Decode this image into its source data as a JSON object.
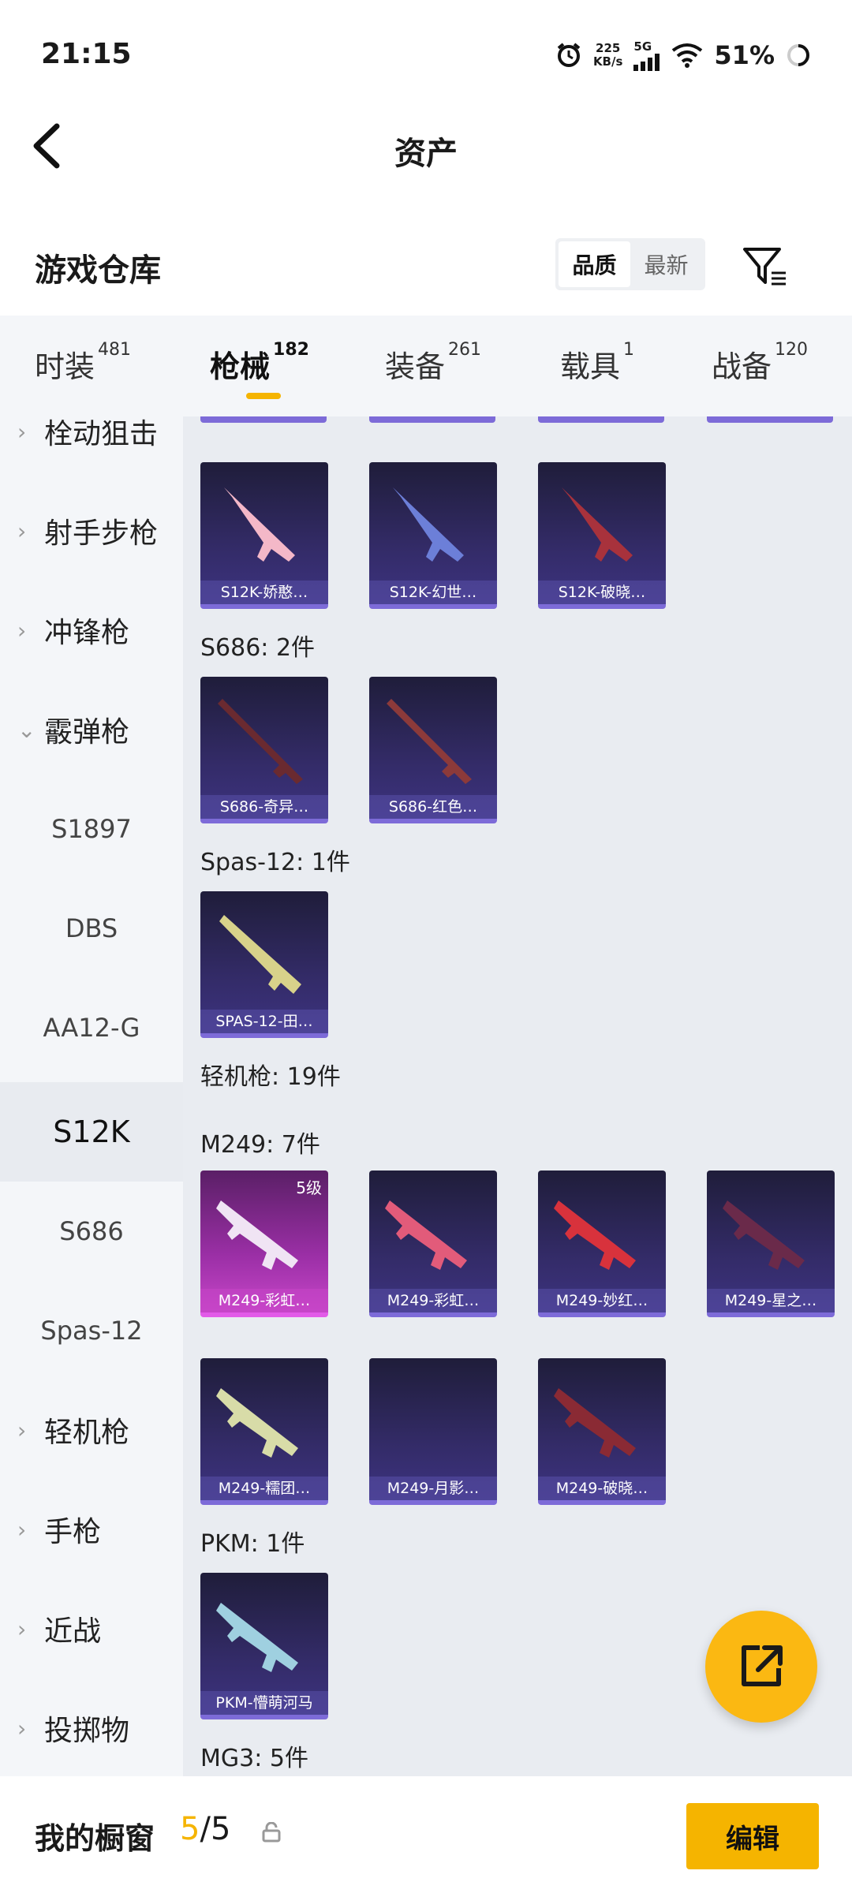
{
  "status_bar": {
    "time": "21:15",
    "network_speed_value": "225",
    "network_speed_unit": "KB/s",
    "signal": "5G",
    "battery": "51%",
    "icons": [
      "alarm-icon",
      "signal-icon",
      "wifi-icon",
      "battery-icon"
    ]
  },
  "header": {
    "title": "资产"
  },
  "warehouse": {
    "title": "游戏仓库",
    "sort_options": [
      "品质",
      "最新"
    ],
    "selected_sort": "品质"
  },
  "tabs": [
    {
      "label": "时装",
      "count": "481"
    },
    {
      "label": "枪械",
      "count": "182",
      "active": true
    },
    {
      "label": "装备",
      "count": "261"
    },
    {
      "label": "载具",
      "count": "1"
    },
    {
      "label": "战备",
      "count": "120"
    }
  ],
  "sidebar": {
    "categories": [
      {
        "label": "栓动狙击",
        "expanded": false
      },
      {
        "label": "射手步枪",
        "expanded": false
      },
      {
        "label": "冲锋枪",
        "expanded": false
      },
      {
        "label": "霰弹枪",
        "expanded": true
      },
      {
        "label": "轻机枪",
        "expanded": false
      },
      {
        "label": "手枪",
        "expanded": false
      },
      {
        "label": "近战",
        "expanded": false
      },
      {
        "label": "投掷物",
        "expanded": false
      }
    ],
    "subitems": [
      "S1897",
      "DBS",
      "AA12-G",
      "S12K",
      "S686",
      "Spas-12"
    ],
    "selected_subitem": "S12K"
  },
  "content": {
    "s12k_items": [
      "S12K-娇憨…",
      "S12K-幻世…",
      "S12K-破晓…"
    ],
    "s686_label": "S686: 2件",
    "s686_items": [
      "S686-奇异…",
      "S686-红色…"
    ],
    "spas_label": "Spas-12: 1件",
    "spas_items": [
      "SPAS-12-田…"
    ],
    "lmg_label": "轻机枪: 19件",
    "m249_label": "M249: 7件",
    "m249_items": [
      {
        "name": "M249-彩虹…",
        "level": "5级"
      },
      {
        "name": "M249-彩虹…"
      },
      {
        "name": "M249-妙红…"
      },
      {
        "name": "M249-星之…"
      },
      {
        "name": "M249-糯团…"
      },
      {
        "name": "M249-月影…"
      },
      {
        "name": "M249-破晓…"
      }
    ],
    "pkm_label": "PKM: 1件",
    "pkm_items": [
      "PKM-懵萌河马"
    ],
    "mg3_label": "MG3: 5件"
  },
  "bottom_bar": {
    "label": "我的橱窗",
    "current": "5",
    "separator": "/",
    "total": "5",
    "edit_label": "编辑"
  },
  "colors": {
    "accent": "#f5b400",
    "card_purple": "#332b67",
    "card_pink": "#9b2fa6",
    "sidebar_bg": "#f4f6f9",
    "content_bg": "#e9ecf1"
  }
}
